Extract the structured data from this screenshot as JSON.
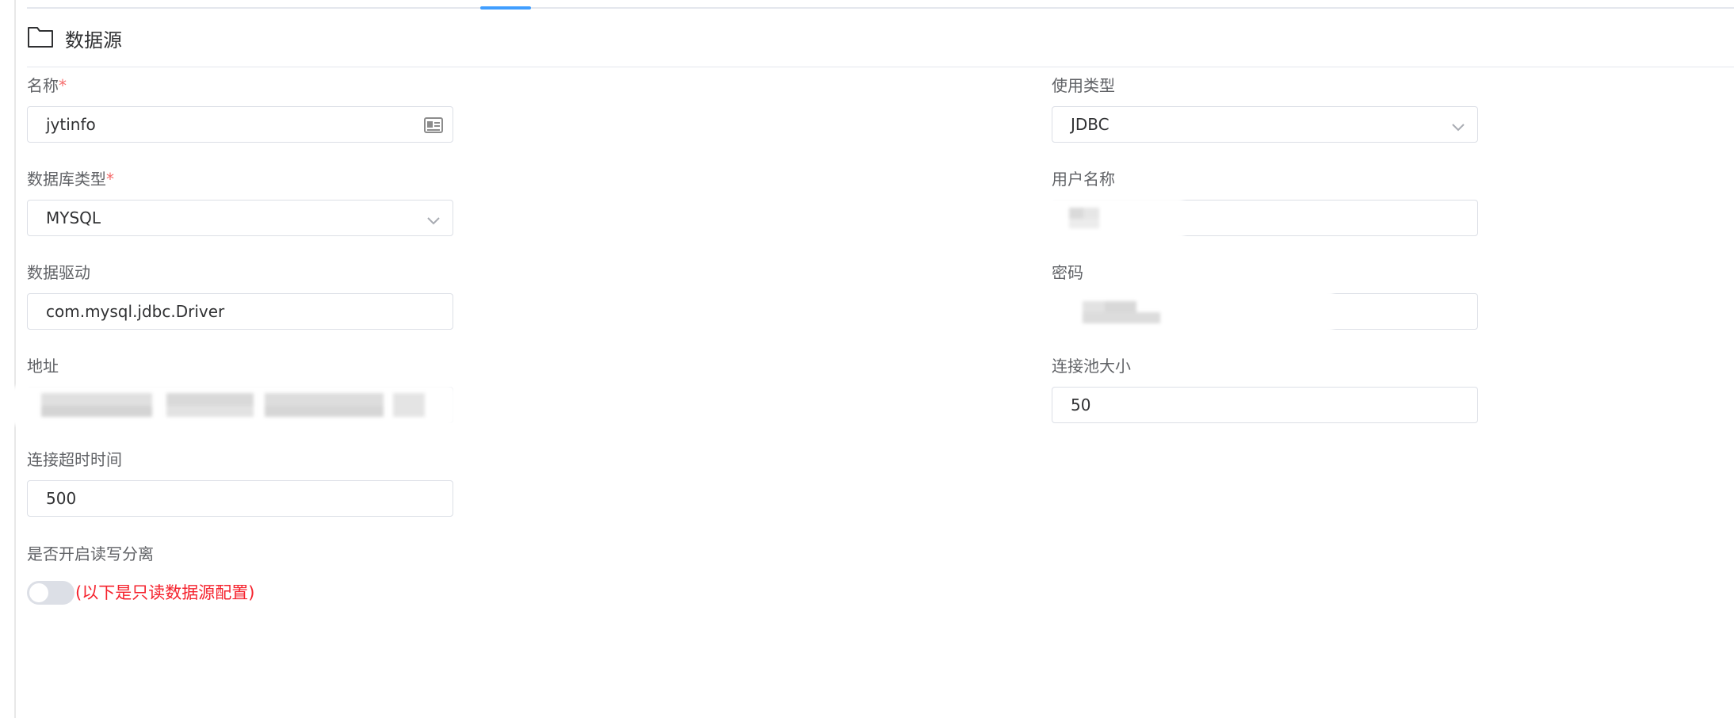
{
  "section": {
    "title": "数据源",
    "icon": "folder-icon"
  },
  "form": {
    "name": {
      "label": "名称",
      "required_mark": "*",
      "value": "jytinfo",
      "suffix_icon": "id-card-icon"
    },
    "usage_type": {
      "label": "使用类型",
      "value": "JDBC"
    },
    "db_type": {
      "label": "数据库类型",
      "required_mark": "*",
      "value": "MYSQL"
    },
    "username": {
      "label": "用户名称",
      "value": ""
    },
    "driver": {
      "label": "数据驱动",
      "value": "com.mysql.jdbc.Driver"
    },
    "password": {
      "label": "密码",
      "value": ""
    },
    "address": {
      "label": "地址",
      "value": ""
    },
    "pool_size": {
      "label": "连接池大小",
      "value": "50"
    },
    "timeout": {
      "label": "连接超时时间",
      "value": "500"
    },
    "read_write_split": {
      "label": "是否开启读写分离",
      "enabled": false,
      "note": "(以下是只读数据源配置)"
    }
  },
  "colors": {
    "accent": "#409eff",
    "required": "#f56c6c",
    "note": "#f5222d"
  }
}
